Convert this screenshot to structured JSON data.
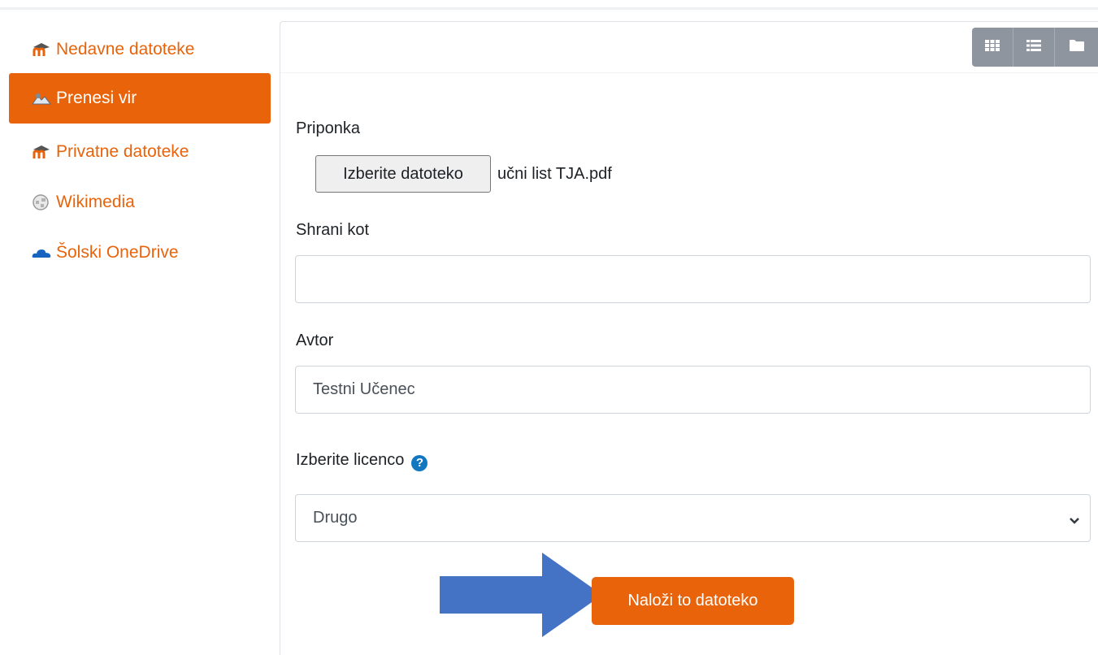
{
  "sidebar": {
    "items": [
      {
        "label": "Nedavne datoteke",
        "icon": "moodle-icon",
        "active": false
      },
      {
        "label": "Prenesi vir",
        "icon": "upload-icon",
        "active": true
      },
      {
        "label": "Privatne datoteke",
        "icon": "moodle-icon",
        "active": false
      },
      {
        "label": "Wikimedia",
        "icon": "wikimedia-icon",
        "active": false
      },
      {
        "label": "Šolski OneDrive",
        "icon": "onedrive-icon",
        "active": false
      }
    ]
  },
  "toolbar": {
    "view_icons": [
      "grid-view-icon",
      "list-view-icon",
      "folder-view-icon"
    ]
  },
  "form": {
    "attachment_label": "Priponka",
    "choose_file_label": "Izberite datoteko",
    "file_name": "učni list TJA.pdf",
    "save_as_label": "Shrani kot",
    "save_as_value": "",
    "author_label": "Avtor",
    "author_value": "Testni Učenec",
    "license_label": "Izberite licenco",
    "license_value": "Drugo",
    "upload_button": "Naloži to datoteko"
  },
  "colors": {
    "accent": "#e8630a",
    "toolbar_gray": "#8f959e",
    "help_blue": "#1177c0",
    "arrow_blue": "#4472c4"
  }
}
